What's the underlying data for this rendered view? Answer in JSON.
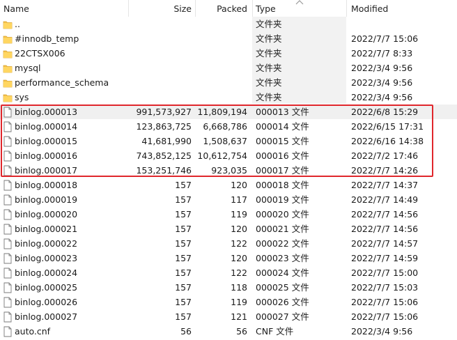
{
  "columns": {
    "name": "Name",
    "size": "Size",
    "packed": "Packed",
    "type": "Type",
    "modified": "Modified",
    "sort_icon": "chevron-up-icon"
  },
  "colors": {
    "highlight": "#e0262b",
    "folder": "#f5c04a",
    "selected_row": "#f0f0f0"
  },
  "rows": [
    {
      "kind": "folder",
      "name": "..",
      "size": "",
      "packed": "",
      "type": "文件夹",
      "modified": ""
    },
    {
      "kind": "folder",
      "name": "#innodb_temp",
      "size": "",
      "packed": "",
      "type": "文件夹",
      "modified": "2022/7/7 15:06"
    },
    {
      "kind": "folder",
      "name": "22CTSX006",
      "size": "",
      "packed": "",
      "type": "文件夹",
      "modified": "2022/7/7 8:33"
    },
    {
      "kind": "folder",
      "name": "mysql",
      "size": "",
      "packed": "",
      "type": "文件夹",
      "modified": "2022/3/4 9:56"
    },
    {
      "kind": "folder",
      "name": "performance_schema",
      "size": "",
      "packed": "",
      "type": "文件夹",
      "modified": "2022/3/4 9:56"
    },
    {
      "kind": "folder",
      "name": "sys",
      "size": "",
      "packed": "",
      "type": "文件夹",
      "modified": "2022/3/4 9:56"
    },
    {
      "kind": "file",
      "name": "binlog.000013",
      "size": "991,573,927",
      "packed": "11,809,194",
      "type": "000013 文件",
      "modified": "2022/6/8 15:29",
      "selected": true
    },
    {
      "kind": "file",
      "name": "binlog.000014",
      "size": "123,863,725",
      "packed": "6,668,786",
      "type": "000014 文件",
      "modified": "2022/6/15 17:31"
    },
    {
      "kind": "file",
      "name": "binlog.000015",
      "size": "41,681,990",
      "packed": "1,508,637",
      "type": "000015 文件",
      "modified": "2022/6/16 14:38"
    },
    {
      "kind": "file",
      "name": "binlog.000016",
      "size": "743,852,125",
      "packed": "10,612,754",
      "type": "000016 文件",
      "modified": "2022/7/2 17:46"
    },
    {
      "kind": "file",
      "name": "binlog.000017",
      "size": "153,251,746",
      "packed": "923,035",
      "type": "000017 文件",
      "modified": "2022/7/7 14:26"
    },
    {
      "kind": "file",
      "name": "binlog.000018",
      "size": "157",
      "packed": "120",
      "type": "000018 文件",
      "modified": "2022/7/7 14:37"
    },
    {
      "kind": "file",
      "name": "binlog.000019",
      "size": "157",
      "packed": "117",
      "type": "000019 文件",
      "modified": "2022/7/7 14:49"
    },
    {
      "kind": "file",
      "name": "binlog.000020",
      "size": "157",
      "packed": "119",
      "type": "000020 文件",
      "modified": "2022/7/7 14:56"
    },
    {
      "kind": "file",
      "name": "binlog.000021",
      "size": "157",
      "packed": "120",
      "type": "000021 文件",
      "modified": "2022/7/7 14:56"
    },
    {
      "kind": "file",
      "name": "binlog.000022",
      "size": "157",
      "packed": "122",
      "type": "000022 文件",
      "modified": "2022/7/7 14:57"
    },
    {
      "kind": "file",
      "name": "binlog.000023",
      "size": "157",
      "packed": "120",
      "type": "000023 文件",
      "modified": "2022/7/7 14:59"
    },
    {
      "kind": "file",
      "name": "binlog.000024",
      "size": "157",
      "packed": "122",
      "type": "000024 文件",
      "modified": "2022/7/7 15:00"
    },
    {
      "kind": "file",
      "name": "binlog.000025",
      "size": "157",
      "packed": "118",
      "type": "000025 文件",
      "modified": "2022/7/7 15:03"
    },
    {
      "kind": "file",
      "name": "binlog.000026",
      "size": "157",
      "packed": "119",
      "type": "000026 文件",
      "modified": "2022/7/7 15:06"
    },
    {
      "kind": "file",
      "name": "binlog.000027",
      "size": "157",
      "packed": "121",
      "type": "000027 文件",
      "modified": "2022/7/7 15:06"
    },
    {
      "kind": "file",
      "name": "auto.cnf",
      "size": "56",
      "packed": "56",
      "type": "CNF 文件",
      "modified": "2022/3/4 9:56"
    }
  ]
}
